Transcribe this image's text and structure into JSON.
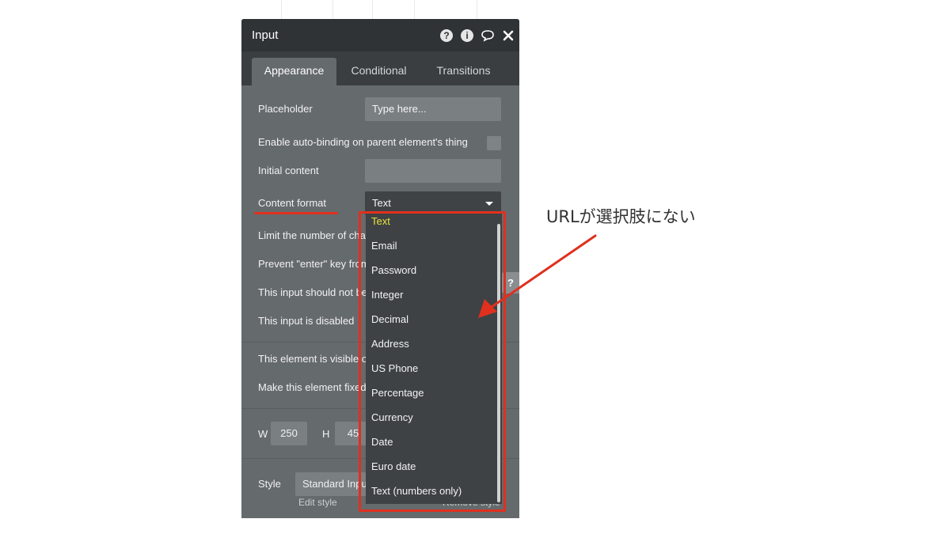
{
  "panel": {
    "title": "Input",
    "icons": [
      "help-icon",
      "info-icon",
      "comment-icon",
      "close-icon"
    ],
    "tabs": [
      {
        "label": "Appearance",
        "active": true
      },
      {
        "label": "Conditional",
        "active": false
      },
      {
        "label": "Transitions",
        "active": false
      }
    ],
    "placeholder": {
      "label": "Placeholder",
      "value": "Type here..."
    },
    "autobinding": {
      "label": "Enable auto-binding on parent element's thing",
      "checked": false
    },
    "initial_content": {
      "label": "Initial content",
      "value": ""
    },
    "content_format": {
      "label": "Content format",
      "value": "Text"
    },
    "limit_label": "Limit the number of cha",
    "prevent_label": "Prevent \"enter\" key from",
    "shouldnot_label": "This input should not be",
    "disabled_label": "This input is disabled",
    "visible_label": "This element is visible o",
    "fixed_label": "Make this element fixed",
    "w_label": "W",
    "w_value": "250",
    "h_label": "H",
    "h_value": "45",
    "style": {
      "label": "Style",
      "value": "Standard Input"
    },
    "edit_style": "Edit style",
    "remove_style": "Remove style",
    "side_tab": "?"
  },
  "dropdown": {
    "options": [
      {
        "label": "Text",
        "selected": true
      },
      {
        "label": "Email",
        "selected": false
      },
      {
        "label": "Password",
        "selected": false
      },
      {
        "label": "Integer",
        "selected": false
      },
      {
        "label": "Decimal",
        "selected": false
      },
      {
        "label": "Address",
        "selected": false
      },
      {
        "label": "US Phone",
        "selected": false
      },
      {
        "label": "Percentage",
        "selected": false
      },
      {
        "label": "Currency",
        "selected": false
      },
      {
        "label": "Date",
        "selected": false
      },
      {
        "label": "Euro date",
        "selected": false
      },
      {
        "label": "Text (numbers only)",
        "selected": false
      }
    ]
  },
  "annotation": {
    "text": "URLが選択肢にない",
    "color": "#e0301e"
  },
  "colors": {
    "panel_bg": "#656a6d",
    "titlebar_bg": "#2f3336",
    "dropdown_bg": "#3e4245",
    "selected_option": "#e9e33a"
  }
}
